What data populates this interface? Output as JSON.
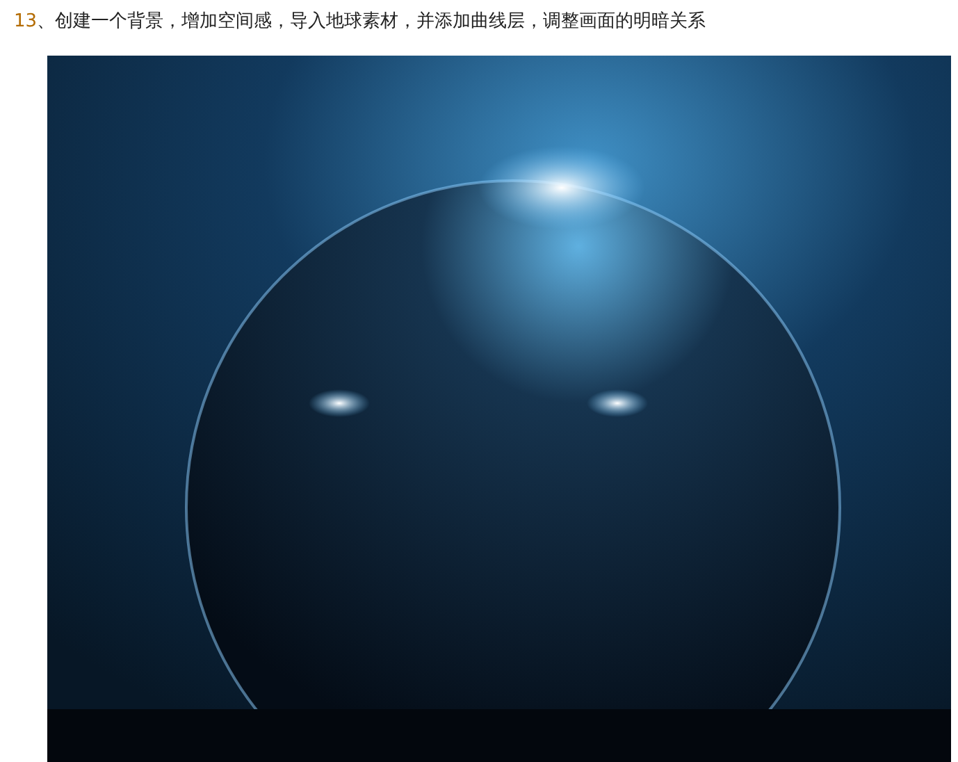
{
  "step": {
    "number": "13",
    "text": "、创建一个背景，增加空间感，导入地球素材，并添加曲线层，调整画面的明暗关系"
  }
}
